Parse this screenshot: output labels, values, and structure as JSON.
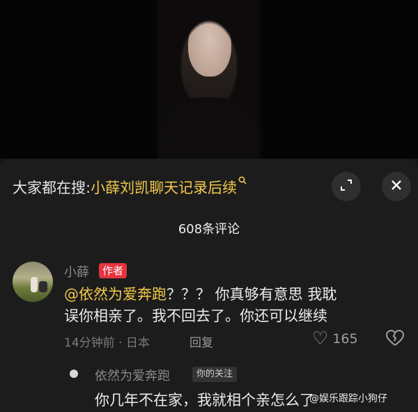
{
  "search": {
    "prefix": "大家都在搜:",
    "query": "小薛刘凯聊天记录后续",
    "icon": "search-icon"
  },
  "header": {
    "comment_count": "608条评论",
    "expand_icon": "expand-icon",
    "close_icon": "close-icon"
  },
  "comment": {
    "author": "小薛",
    "badge": "作者",
    "mention": "@依然为爱奔跑",
    "text_line1": "？？？ 你真够有意思 我耽",
    "text_line2": "误你相亲了。我不回去了。你还可以继续",
    "time_location": "14分钟前 · 日本",
    "reply_label": "回复",
    "likes": "165"
  },
  "reply": {
    "author": "依然为爱奔跑",
    "badge": "你的关注",
    "text": "你几年不在家，我就相个亲怎么了"
  },
  "watermark": "@娱乐跟踪小狗仔",
  "colors": {
    "accent": "#f2c94c",
    "badge_red": "#e5343e",
    "panel_bg": "#1c1c1c"
  }
}
